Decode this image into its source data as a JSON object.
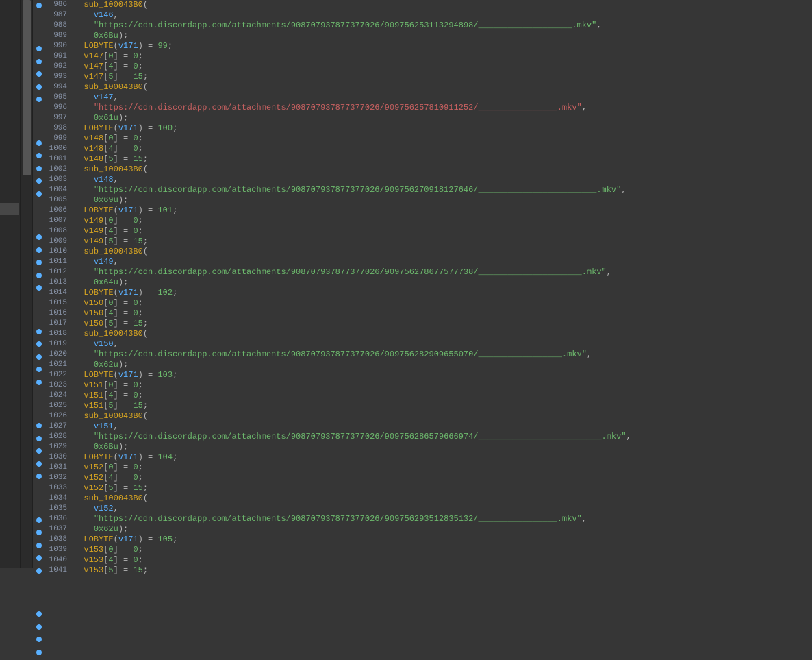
{
  "startLine": 986,
  "blocks": [
    {
      "vout": "v146",
      "url": "\"https://cdn.discordapp.com/attachments/908707937877377026/909756253113294898/___________________.mkv\"",
      "hex": "0x6Bu",
      "lob": "99",
      "vnext": "v147",
      "partial_open": true,
      "urlcolor": "str"
    },
    {
      "vout": "v147",
      "url": "\"https://cdn.discordapp.com/attachments/908707937877377026/909756257810911252/________________.mkv\"",
      "hex": "0x61u",
      "lob": "100",
      "vnext": "v148",
      "urlcolor": "strred"
    },
    {
      "vout": "v148",
      "url": "\"https://cdn.discordapp.com/attachments/908707937877377026/909756270918127646/________________________.mkv\"",
      "hex": "0x69u",
      "lob": "101",
      "vnext": "v149",
      "urlcolor": "str"
    },
    {
      "vout": "v149",
      "url": "\"https://cdn.discordapp.com/attachments/908707937877377026/909756278677577738/_____________________.mkv\"",
      "hex": "0x64u",
      "lob": "102",
      "vnext": "v150",
      "urlcolor": "str"
    },
    {
      "vout": "v150",
      "url": "\"https://cdn.discordapp.com/attachments/908707937877377026/909756282909655070/_________________.mkv\"",
      "hex": "0x62u",
      "lob": "103",
      "vnext": "v151",
      "urlcolor": "str"
    },
    {
      "vout": "v151",
      "url": "\"https://cdn.discordapp.com/attachments/908707937877377026/909756286579666974/_________________________.mkv\"",
      "hex": "0x6Bu",
      "lob": "104",
      "vnext": "v152",
      "urlcolor": "str"
    },
    {
      "vout": "v152",
      "url": "\"https://cdn.discordapp.com/attachments/908707937877377026/909756293512835132/________________.mkv\"",
      "hex": "0x62u",
      "lob": "105",
      "vnext": "v153",
      "urlcolor": "str"
    }
  ],
  "tail": {
    "vnext": "v153"
  },
  "subname": "sub_100043B0",
  "lobvar": "v171",
  "lobfn": "LOBYTE"
}
